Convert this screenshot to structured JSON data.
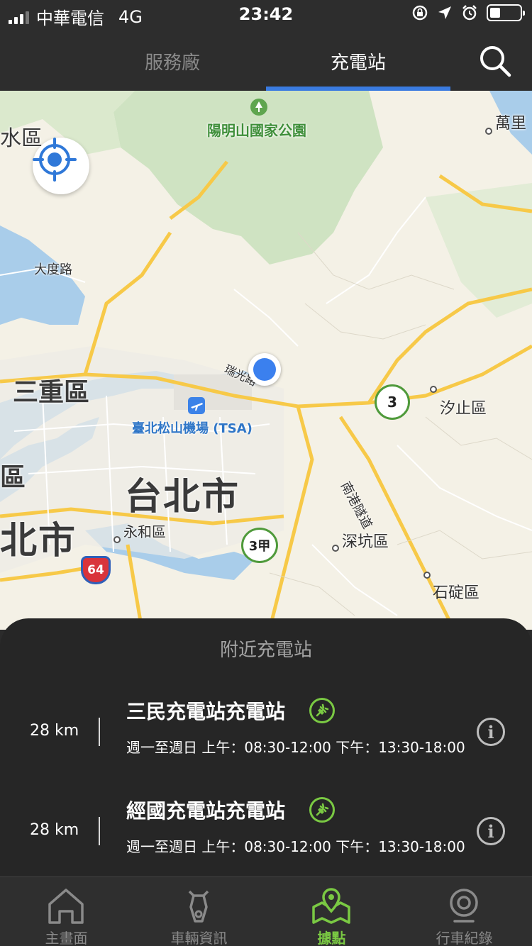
{
  "status_bar": {
    "carrier": "中華電信",
    "network": "4G",
    "time": "23:42",
    "battery_level": 0.35,
    "icons": [
      "signal-icon",
      "screen-lock-icon",
      "location-arrow-icon",
      "alarm-icon",
      "battery-icon"
    ]
  },
  "header": {
    "tabs": [
      {
        "label": "服務廠",
        "active": false
      },
      {
        "label": "充電站",
        "active": true
      }
    ],
    "search_icon": "search-icon",
    "accent_color": "#3a7be0"
  },
  "map": {
    "labels": {
      "shuiqu": "水區",
      "yangmingshan": "陽明山國家公園",
      "wanli": "萬里",
      "dadu_road": "大度路",
      "sanchong": "三重區",
      "ruiguang_road": "瑞光路",
      "songshan_airport": "臺北松山機場 (TSA)",
      "xizhi": "汐止區",
      "taipei_city": "台北市",
      "district_partial": "區",
      "new_taipei_partial": "北市",
      "nangang_tunnel": "南港隧道",
      "yonghe": "永和區",
      "shenkeng": "深坑區",
      "shiding": "石碇區"
    },
    "route_shields": [
      "3",
      "3甲",
      "64"
    ],
    "locate_icon": "crosshair-icon"
  },
  "nearby": {
    "title": "附近充電站",
    "stations": [
      {
        "distance": "28 km",
        "name": "三民充電站充電站",
        "hours": "週一至週日 上午：08:30-12:00 下午：13:30-18:00"
      },
      {
        "distance": "28 km",
        "name": "經國充電站充電站",
        "hours": "週一至週日 上午：08:30-12:00 下午：13:30-18:00"
      }
    ],
    "plug_icon": "charging-plug-icon",
    "info_icon": "info-icon",
    "info_glyph": "i"
  },
  "tabbar": {
    "items": [
      {
        "label": "主畫面",
        "icon": "home-icon",
        "active": false
      },
      {
        "label": "車輛資訊",
        "icon": "scooter-icon",
        "active": false
      },
      {
        "label": "據點",
        "icon": "map-pin-icon",
        "active": true
      },
      {
        "label": "行車紀錄",
        "icon": "camera-icon",
        "active": false
      }
    ],
    "active_color": "#7ac943"
  }
}
